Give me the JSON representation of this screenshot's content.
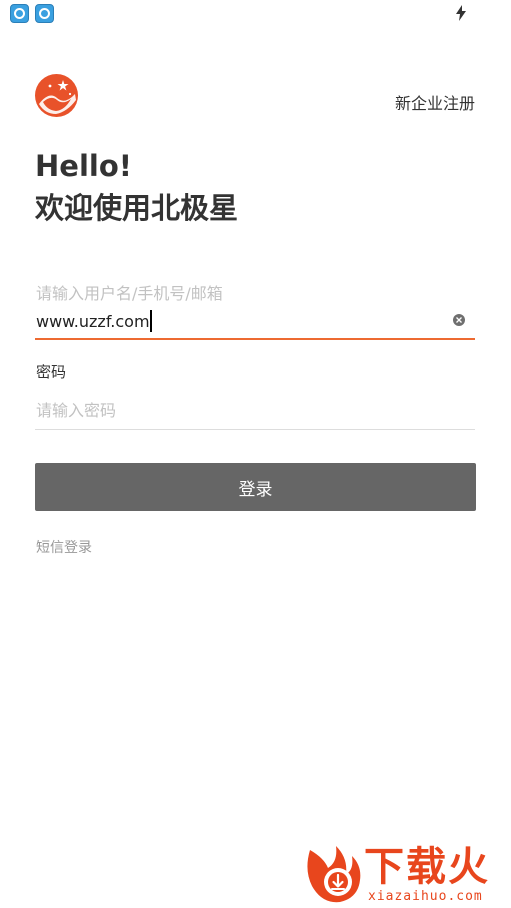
{
  "status_bar": {
    "icons": [
      "app-notification-icon",
      "app-notification-icon",
      "charging-bolt-icon"
    ]
  },
  "header": {
    "logo_icon": "north-star-logo-icon",
    "register_link": "新企业注册"
  },
  "greeting": {
    "hello": "Hello!",
    "welcome": "欢迎使用北极星"
  },
  "form": {
    "username": {
      "label": "请输入用户名/手机号/邮箱",
      "value": "www.uzzf.com",
      "clear_icon": "clear-circle-icon"
    },
    "password": {
      "label": "密码",
      "placeholder": "请输入密码",
      "value": ""
    },
    "login_button": "登录",
    "sms_login_link": "短信登录"
  },
  "watermark": {
    "brand": "下载火",
    "site": "xiazaihuo.com"
  },
  "colors": {
    "accent": "#ed6a31",
    "button_bg": "#666666",
    "watermark": "#e8461d",
    "logo": "#e8522a"
  }
}
